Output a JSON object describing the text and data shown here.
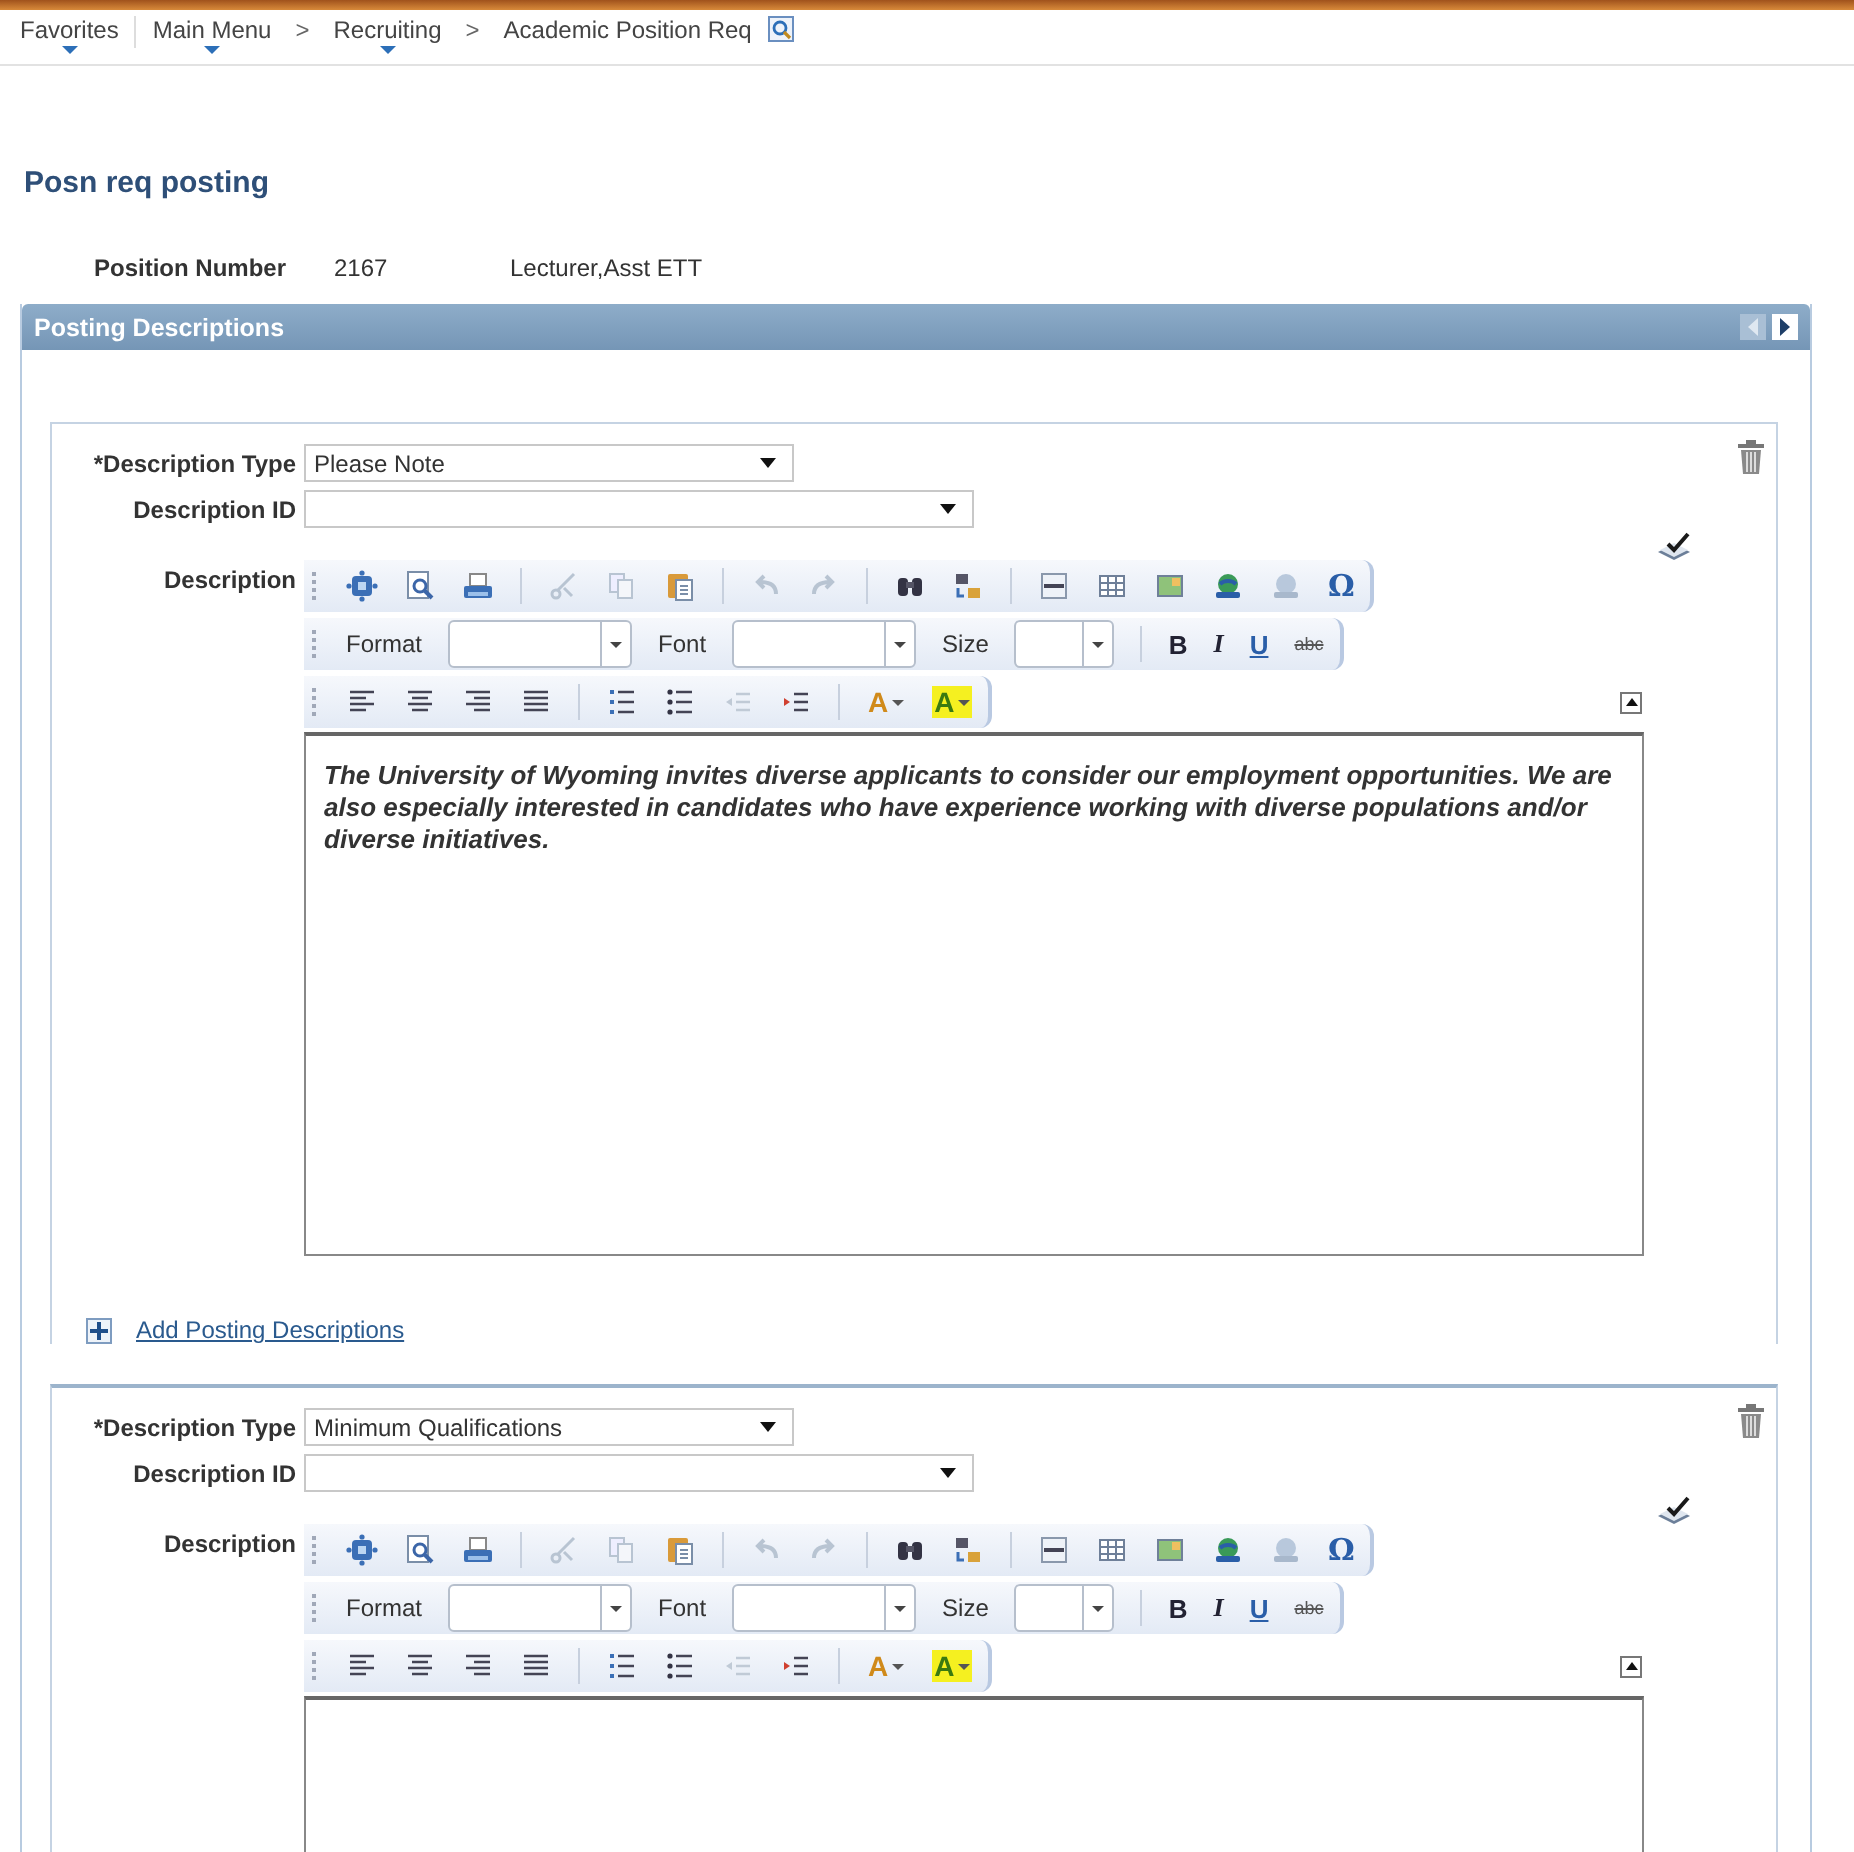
{
  "breadcrumb": [
    {
      "kind": "menu",
      "label": "Favorites"
    },
    {
      "kind": "menu",
      "label": "Main Menu"
    },
    {
      "kind": "separator",
      "label": ">"
    },
    {
      "kind": "menu",
      "label": "Recruiting"
    },
    {
      "kind": "separator",
      "label": ">"
    },
    {
      "kind": "current",
      "label": "Academic Position Req"
    }
  ],
  "page_title": "Posn req posting",
  "position": {
    "label": "Position Number",
    "number": "2167",
    "title": "Lecturer,Asst ETT"
  },
  "panel": {
    "title": "Posting Descriptions",
    "previous_disabled": true,
    "next_disabled": false,
    "descriptions": [
      {
        "type_label": "*Description Type",
        "type_value": "Please Note",
        "id_label": "Description ID",
        "description_label": "Description",
        "toolbar": {
          "special_char": "Ω",
          "format_label": "Format",
          "font_label": "Font",
          "size_label": "Size",
          "bold": "B",
          "italic": "I",
          "underline": "U",
          "strike": "abc",
          "text_color": "A",
          "bg_color": "A"
        },
        "text": "The University of Wyoming invites diverse applicants to consider our employment opportunities. We are also especially interested in candidates who have experience working with diverse populations and/or diverse initiatives.",
        "add_link": "Add Posting Descriptions"
      },
      {
        "type_label": "*Description Type",
        "type_value": "Minimum Qualifications",
        "id_label": "Description ID",
        "description_label": "Description",
        "toolbar": {
          "special_char": "Ω",
          "format_label": "Format",
          "font_label": "Font",
          "size_label": "Size",
          "bold": "B",
          "italic": "I",
          "underline": "U",
          "strike": "abc",
          "text_color": "A",
          "bg_color": "A"
        }
      }
    ]
  }
}
